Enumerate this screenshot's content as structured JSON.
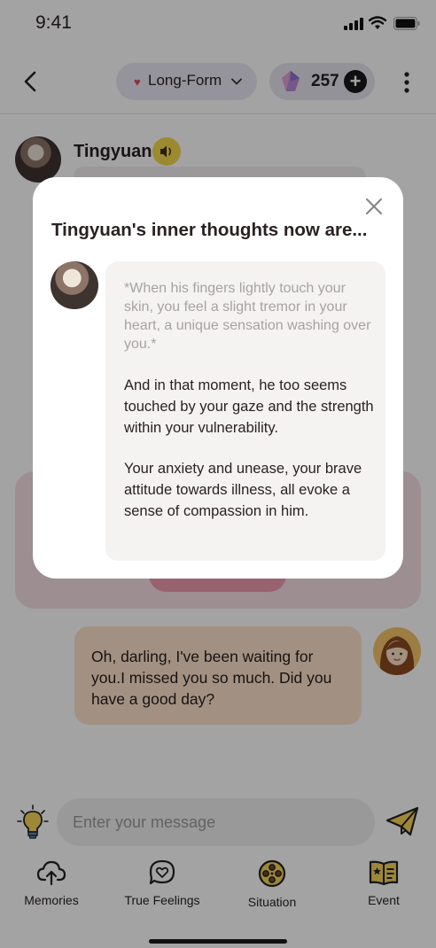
{
  "status": {
    "time": "9:41"
  },
  "header": {
    "mode_label": "Long-Form",
    "coin_count": "257",
    "plus_label": "+"
  },
  "character": {
    "name": "Tingyuan"
  },
  "user_message": {
    "text": "Oh, darling, I've been waiting for you.I missed you so much. Did you have a good day?"
  },
  "composer": {
    "placeholder": "Enter your message"
  },
  "bottom_nav": [
    {
      "label": "Memories",
      "icon": "cloud-upload-icon"
    },
    {
      "label": "True Feelings",
      "icon": "heart-chat-icon"
    },
    {
      "label": "Situation",
      "icon": "film-reel-icon"
    },
    {
      "label": "Event",
      "icon": "event-book-icon"
    }
  ],
  "modal": {
    "title": "Tingyuan's inner thoughts now are...",
    "italic": "*When his fingers lightly touch your skin, you feel a slight tremor in your heart, a unique sensation washing over you.*",
    "paragraph1": "And in that moment, he too seems touched by your gaze and the strength within your vulnerability.",
    "paragraph2": "Your anxiety and unease, your brave attitude towards illness, all evoke a sense of compassion in him."
  },
  "colors": {
    "accent_yellow": "#f5d84e",
    "pill_bg": "#eae7f2",
    "user_bubble": "#fde3cc",
    "thought_card": "#f5f3f2"
  }
}
